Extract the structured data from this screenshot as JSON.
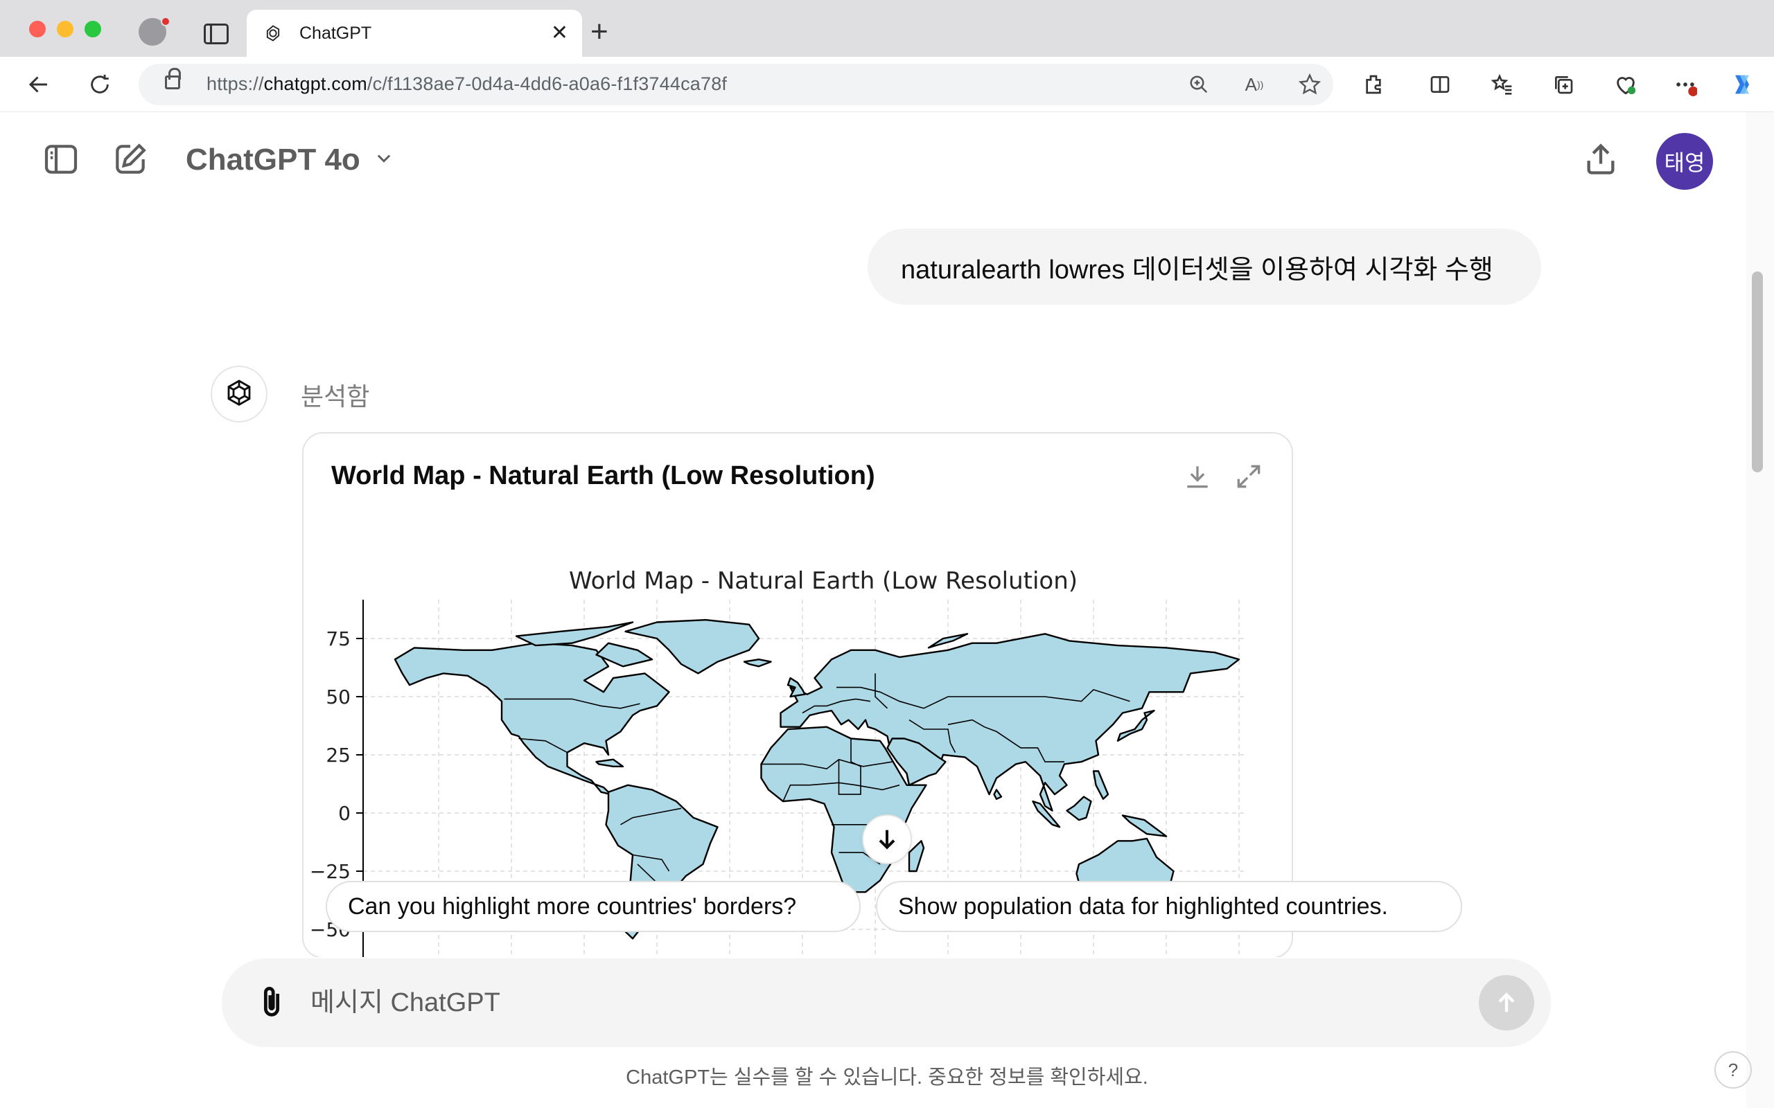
{
  "browser": {
    "tab_title": "ChatGPT",
    "tab_favicon": "openai-logo-icon",
    "url_prefix": "https://",
    "url_host": "chatgpt.com",
    "url_path": "/c/f1138ae7-0d4a-4dd6-a0a6-f1f3744ca78f",
    "icons": [
      "back-icon",
      "reload-icon",
      "zoom-icon",
      "read-aloud-icon",
      "favorite-star-icon",
      "extensions-icon",
      "split-screen-icon",
      "favorites-icon",
      "collections-icon",
      "browser-essentials-icon",
      "more-icon",
      "copilot-icon"
    ]
  },
  "header": {
    "model_name": "ChatGPT 4o",
    "avatar_initials": "태영",
    "avatar_color": "#5036a6"
  },
  "conversation": {
    "user_message": "naturalearth lowres 데이터셋을 이용하여 시각화 수행",
    "assistant_status": "분석함",
    "card_title": "World Map - Natural Earth (Low Resolution)"
  },
  "chart_data": {
    "type": "map",
    "title": "World Map - Natural Earth (Low Resolution)",
    "xlabel": "",
    "ylabel": "",
    "ytick_labels": [
      "75",
      "50",
      "25",
      "0",
      "−25",
      "−50"
    ],
    "yticks": [
      75,
      50,
      25,
      0,
      -25,
      -50
    ],
    "xlim": [
      -180,
      180
    ],
    "ylim": [
      -90,
      90
    ],
    "grid": true,
    "fill_color": "#add8e6",
    "edge_color": "#000000"
  },
  "suggestions": [
    "Can you highlight more countries' borders?",
    "Show population data for highlighted countries."
  ],
  "composer": {
    "placeholder": "메시지 ChatGPT",
    "disclaimer": "ChatGPT는 실수를 할 수 있습니다. 중요한 정보를 확인하세요.",
    "help_label": "?"
  }
}
